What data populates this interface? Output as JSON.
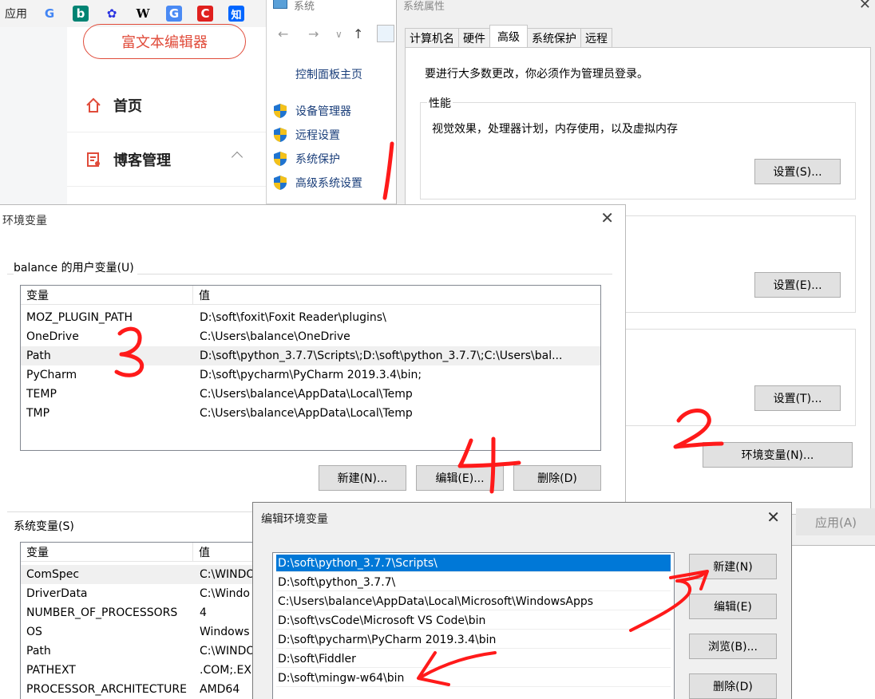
{
  "bookmarks": {
    "label": "应用",
    "icons": [
      {
        "glyph": "G",
        "name": "google-icon",
        "color": "#4285f4"
      },
      {
        "glyph": "b",
        "name": "bing-icon",
        "color": "#008373"
      },
      {
        "glyph": "✿",
        "name": "baidu-icon",
        "color": "#2932e1"
      },
      {
        "glyph": "W",
        "name": "wikipedia-icon",
        "color": "#222222"
      },
      {
        "glyph": "G",
        "name": "translate-icon",
        "color": "#4a8af4"
      },
      {
        "glyph": "C",
        "name": "csdn-icon",
        "color": "#e0201e"
      },
      {
        "glyph": "知",
        "name": "zhihu-icon",
        "color": "#0066ff"
      }
    ]
  },
  "blog": {
    "rich_text_button": "富文本编辑器",
    "nav": [
      {
        "label": "首页",
        "icon": "home-icon"
      },
      {
        "label": "博客管理",
        "icon": "blog-manage-icon"
      }
    ]
  },
  "system_window": {
    "title": "系统",
    "home_link": "控制面板主页",
    "links": [
      "设备管理器",
      "远程设置",
      "系统保护",
      "高级系统设置"
    ]
  },
  "system_properties": {
    "title": "系统属性",
    "tabs": [
      "计算机名",
      "硬件",
      "高级",
      "系统保护",
      "远程"
    ],
    "active_tab": "高级",
    "admin_note": "要进行大多数更改，你必须作为管理员登录。",
    "performance": {
      "title": "性能",
      "description": "视觉效果，处理器计划，内存使用，以及虚拟内存",
      "button": "设置(S)..."
    },
    "profile_button": "设置(E)...",
    "startup_button": "设置(T)...",
    "env_button": "环境变量(N)...",
    "apply_button": "应用(A)"
  },
  "env_dialog": {
    "title": "环境变量",
    "user_group_label": "balance 的用户变量(U)",
    "columns": [
      "变量",
      "值"
    ],
    "user_vars": [
      {
        "name": "MOZ_PLUGIN_PATH",
        "value": "D:\\soft\\foxit\\Foxit Reader\\plugins\\"
      },
      {
        "name": "OneDrive",
        "value": "C:\\Users\\balance\\OneDrive"
      },
      {
        "name": "Path",
        "value": "D:\\soft\\python_3.7.7\\Scripts\\;D:\\soft\\python_3.7.7\\;C:\\Users\\bal..."
      },
      {
        "name": "PyCharm",
        "value": "D:\\soft\\pycharm\\PyCharm 2019.3.4\\bin;"
      },
      {
        "name": "TEMP",
        "value": "C:\\Users\\balance\\AppData\\Local\\Temp"
      },
      {
        "name": "TMP",
        "value": "C:\\Users\\balance\\AppData\\Local\\Temp"
      }
    ],
    "user_buttons": {
      "new": "新建(N)...",
      "edit": "编辑(E)...",
      "delete": "删除(D)"
    },
    "system_group_label": "系统变量(S)",
    "system_vars": [
      {
        "name": "ComSpec",
        "value": "C:\\WINDO"
      },
      {
        "name": "DriverData",
        "value": "C:\\Windo"
      },
      {
        "name": "NUMBER_OF_PROCESSORS",
        "value": "4"
      },
      {
        "name": "OS",
        "value": "Windows"
      },
      {
        "name": "Path",
        "value": "C:\\WINDO"
      },
      {
        "name": "PATHEXT",
        "value": ".COM;.EX"
      },
      {
        "name": "PROCESSOR_ARCHITECTURE",
        "value": "AMD64"
      }
    ]
  },
  "edit_dialog": {
    "title": "编辑环境变量",
    "entries": [
      "D:\\soft\\python_3.7.7\\Scripts\\",
      "D:\\soft\\python_3.7.7\\",
      "C:\\Users\\balance\\AppData\\Local\\Microsoft\\WindowsApps",
      "D:\\soft\\vsCode\\Microsoft VS Code\\bin",
      "D:\\soft\\pycharm\\PyCharm 2019.3.4\\bin",
      "D:\\soft\\Fiddler",
      "D:\\soft\\mingw-w64\\bin"
    ],
    "buttons": {
      "new": "新建(N)",
      "edit": "编辑(E)",
      "browse": "浏览(B)...",
      "delete": "删除(D)"
    }
  },
  "annotations": {
    "color": "#ff1a1a",
    "steps": [
      "1",
      "2",
      "3",
      "4"
    ]
  }
}
